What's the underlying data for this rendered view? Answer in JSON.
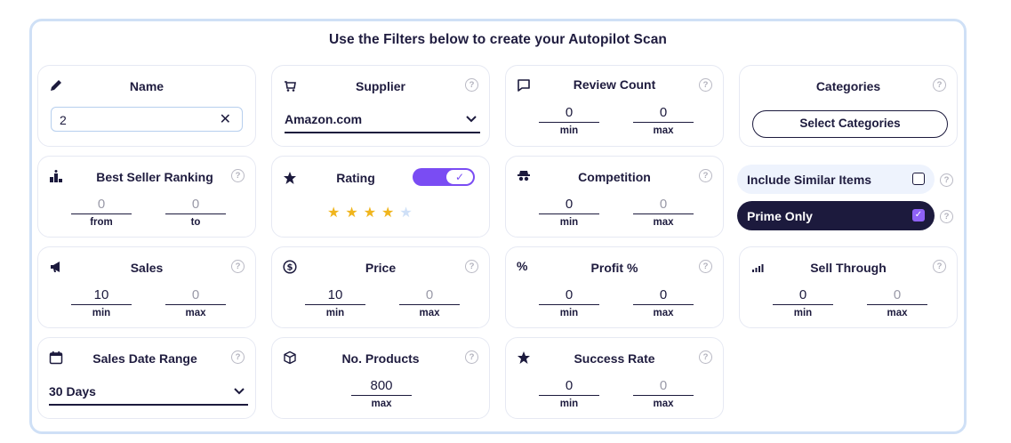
{
  "heading": "Use the Filters below to create your Autopilot Scan",
  "help_glyph": "?",
  "name": {
    "title": "Name",
    "value": "2",
    "clear": "✕"
  },
  "supplier": {
    "title": "Supplier",
    "value": "Amazon.com"
  },
  "review_count": {
    "title": "Review Count",
    "min": "0",
    "max": "0",
    "min_label": "min",
    "max_label": "max"
  },
  "categories": {
    "title": "Categories",
    "button": "Select Categories"
  },
  "best_seller": {
    "title": "Best Seller Ranking",
    "from": "0",
    "to": "0",
    "from_label": "from",
    "to_label": "to"
  },
  "rating": {
    "title": "Rating",
    "toggle_on": true,
    "check": "✓",
    "stars": 4,
    "max_stars": 5,
    "star_glyph": "★",
    "star_color": "#f0b51d",
    "star_empty_color": "#cfe0f7"
  },
  "competition": {
    "title": "Competition",
    "min": "0",
    "max": "0",
    "min_label": "min",
    "max_label": "max"
  },
  "include_similar": {
    "label": "Include Similar Items",
    "checked": false
  },
  "prime_only": {
    "label": "Prime Only",
    "checked": true,
    "check": "✓"
  },
  "sales": {
    "title": "Sales",
    "min": "10",
    "max": "0",
    "min_label": "min",
    "max_label": "max"
  },
  "price": {
    "title": "Price",
    "min": "10",
    "max": "0",
    "min_label": "min",
    "max_label": "max"
  },
  "profit": {
    "title": "Profit %",
    "min": "0",
    "max": "0",
    "min_label": "min",
    "max_label": "max",
    "icon_glyph": "%"
  },
  "sell_through": {
    "title": "Sell Through",
    "min": "0",
    "max": "0",
    "min_label": "min",
    "max_label": "max"
  },
  "sales_date": {
    "title": "Sales Date Range",
    "value": "30 Days"
  },
  "products": {
    "title": "No. Products",
    "max": "800",
    "max_label": "max"
  },
  "success_rate": {
    "title": "Success Rate",
    "min": "0",
    "max": "0",
    "min_label": "min",
    "max_label": "max"
  },
  "colors": {
    "accent": "#7a4cf3",
    "navy": "#1c1a3d",
    "border": "#e6e9f3",
    "frame": "#cfe0f6"
  }
}
